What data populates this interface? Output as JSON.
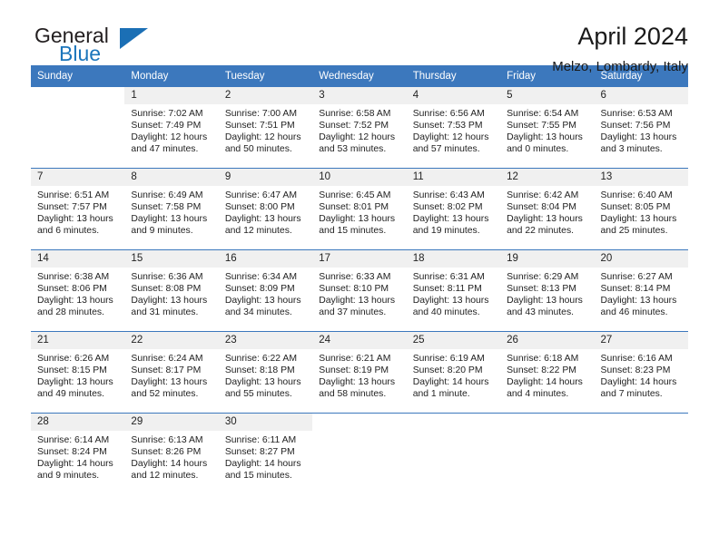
{
  "brand": {
    "name_top": "General",
    "name_bottom": "Blue",
    "triangle_color": "#1b6fb5",
    "blue_color": "#1b75bb"
  },
  "header": {
    "title": "April 2024",
    "subtitle": "Melzo, Lombardy, Italy"
  },
  "theme": {
    "header_blue": "#3c78bd",
    "daynum_band": "#f0f0f0",
    "text": "#222222"
  },
  "weekday_headers": [
    "Sunday",
    "Monday",
    "Tuesday",
    "Wednesday",
    "Thursday",
    "Friday",
    "Saturday"
  ],
  "labels": {
    "sunrise_prefix": "Sunrise:",
    "sunset_prefix": "Sunset:",
    "daylight_prefix": "Daylight:"
  },
  "weeks": [
    [
      {
        "day": "",
        "blank": true,
        "sunrise": "",
        "sunset": "",
        "daylight_line1": "",
        "daylight_line2": ""
      },
      {
        "day": "1",
        "sunrise": "Sunrise: 7:02 AM",
        "sunset": "Sunset: 7:49 PM",
        "daylight_line1": "Daylight: 12 hours",
        "daylight_line2": "and 47 minutes."
      },
      {
        "day": "2",
        "sunrise": "Sunrise: 7:00 AM",
        "sunset": "Sunset: 7:51 PM",
        "daylight_line1": "Daylight: 12 hours",
        "daylight_line2": "and 50 minutes."
      },
      {
        "day": "3",
        "sunrise": "Sunrise: 6:58 AM",
        "sunset": "Sunset: 7:52 PM",
        "daylight_line1": "Daylight: 12 hours",
        "daylight_line2": "and 53 minutes."
      },
      {
        "day": "4",
        "sunrise": "Sunrise: 6:56 AM",
        "sunset": "Sunset: 7:53 PM",
        "daylight_line1": "Daylight: 12 hours",
        "daylight_line2": "and 57 minutes."
      },
      {
        "day": "5",
        "sunrise": "Sunrise: 6:54 AM",
        "sunset": "Sunset: 7:55 PM",
        "daylight_line1": "Daylight: 13 hours",
        "daylight_line2": "and 0 minutes."
      },
      {
        "day": "6",
        "sunrise": "Sunrise: 6:53 AM",
        "sunset": "Sunset: 7:56 PM",
        "daylight_line1": "Daylight: 13 hours",
        "daylight_line2": "and 3 minutes."
      }
    ],
    [
      {
        "day": "7",
        "sunrise": "Sunrise: 6:51 AM",
        "sunset": "Sunset: 7:57 PM",
        "daylight_line1": "Daylight: 13 hours",
        "daylight_line2": "and 6 minutes."
      },
      {
        "day": "8",
        "sunrise": "Sunrise: 6:49 AM",
        "sunset": "Sunset: 7:58 PM",
        "daylight_line1": "Daylight: 13 hours",
        "daylight_line2": "and 9 minutes."
      },
      {
        "day": "9",
        "sunrise": "Sunrise: 6:47 AM",
        "sunset": "Sunset: 8:00 PM",
        "daylight_line1": "Daylight: 13 hours",
        "daylight_line2": "and 12 minutes."
      },
      {
        "day": "10",
        "sunrise": "Sunrise: 6:45 AM",
        "sunset": "Sunset: 8:01 PM",
        "daylight_line1": "Daylight: 13 hours",
        "daylight_line2": "and 15 minutes."
      },
      {
        "day": "11",
        "sunrise": "Sunrise: 6:43 AM",
        "sunset": "Sunset: 8:02 PM",
        "daylight_line1": "Daylight: 13 hours",
        "daylight_line2": "and 19 minutes."
      },
      {
        "day": "12",
        "sunrise": "Sunrise: 6:42 AM",
        "sunset": "Sunset: 8:04 PM",
        "daylight_line1": "Daylight: 13 hours",
        "daylight_line2": "and 22 minutes."
      },
      {
        "day": "13",
        "sunrise": "Sunrise: 6:40 AM",
        "sunset": "Sunset: 8:05 PM",
        "daylight_line1": "Daylight: 13 hours",
        "daylight_line2": "and 25 minutes."
      }
    ],
    [
      {
        "day": "14",
        "sunrise": "Sunrise: 6:38 AM",
        "sunset": "Sunset: 8:06 PM",
        "daylight_line1": "Daylight: 13 hours",
        "daylight_line2": "and 28 minutes."
      },
      {
        "day": "15",
        "sunrise": "Sunrise: 6:36 AM",
        "sunset": "Sunset: 8:08 PM",
        "daylight_line1": "Daylight: 13 hours",
        "daylight_line2": "and 31 minutes."
      },
      {
        "day": "16",
        "sunrise": "Sunrise: 6:34 AM",
        "sunset": "Sunset: 8:09 PM",
        "daylight_line1": "Daylight: 13 hours",
        "daylight_line2": "and 34 minutes."
      },
      {
        "day": "17",
        "sunrise": "Sunrise: 6:33 AM",
        "sunset": "Sunset: 8:10 PM",
        "daylight_line1": "Daylight: 13 hours",
        "daylight_line2": "and 37 minutes."
      },
      {
        "day": "18",
        "sunrise": "Sunrise: 6:31 AM",
        "sunset": "Sunset: 8:11 PM",
        "daylight_line1": "Daylight: 13 hours",
        "daylight_line2": "and 40 minutes."
      },
      {
        "day": "19",
        "sunrise": "Sunrise: 6:29 AM",
        "sunset": "Sunset: 8:13 PM",
        "daylight_line1": "Daylight: 13 hours",
        "daylight_line2": "and 43 minutes."
      },
      {
        "day": "20",
        "sunrise": "Sunrise: 6:27 AM",
        "sunset": "Sunset: 8:14 PM",
        "daylight_line1": "Daylight: 13 hours",
        "daylight_line2": "and 46 minutes."
      }
    ],
    [
      {
        "day": "21",
        "sunrise": "Sunrise: 6:26 AM",
        "sunset": "Sunset: 8:15 PM",
        "daylight_line1": "Daylight: 13 hours",
        "daylight_line2": "and 49 minutes."
      },
      {
        "day": "22",
        "sunrise": "Sunrise: 6:24 AM",
        "sunset": "Sunset: 8:17 PM",
        "daylight_line1": "Daylight: 13 hours",
        "daylight_line2": "and 52 minutes."
      },
      {
        "day": "23",
        "sunrise": "Sunrise: 6:22 AM",
        "sunset": "Sunset: 8:18 PM",
        "daylight_line1": "Daylight: 13 hours",
        "daylight_line2": "and 55 minutes."
      },
      {
        "day": "24",
        "sunrise": "Sunrise: 6:21 AM",
        "sunset": "Sunset: 8:19 PM",
        "daylight_line1": "Daylight: 13 hours",
        "daylight_line2": "and 58 minutes."
      },
      {
        "day": "25",
        "sunrise": "Sunrise: 6:19 AM",
        "sunset": "Sunset: 8:20 PM",
        "daylight_line1": "Daylight: 14 hours",
        "daylight_line2": "and 1 minute."
      },
      {
        "day": "26",
        "sunrise": "Sunrise: 6:18 AM",
        "sunset": "Sunset: 8:22 PM",
        "daylight_line1": "Daylight: 14 hours",
        "daylight_line2": "and 4 minutes."
      },
      {
        "day": "27",
        "sunrise": "Sunrise: 6:16 AM",
        "sunset": "Sunset: 8:23 PM",
        "daylight_line1": "Daylight: 14 hours",
        "daylight_line2": "and 7 minutes."
      }
    ],
    [
      {
        "day": "28",
        "sunrise": "Sunrise: 6:14 AM",
        "sunset": "Sunset: 8:24 PM",
        "daylight_line1": "Daylight: 14 hours",
        "daylight_line2": "and 9 minutes."
      },
      {
        "day": "29",
        "sunrise": "Sunrise: 6:13 AM",
        "sunset": "Sunset: 8:26 PM",
        "daylight_line1": "Daylight: 14 hours",
        "daylight_line2": "and 12 minutes."
      },
      {
        "day": "30",
        "sunrise": "Sunrise: 6:11 AM",
        "sunset": "Sunset: 8:27 PM",
        "daylight_line1": "Daylight: 14 hours",
        "daylight_line2": "and 15 minutes."
      },
      {
        "day": "",
        "blank": true,
        "sunrise": "",
        "sunset": "",
        "daylight_line1": "",
        "daylight_line2": ""
      },
      {
        "day": "",
        "blank": true,
        "sunrise": "",
        "sunset": "",
        "daylight_line1": "",
        "daylight_line2": ""
      },
      {
        "day": "",
        "blank": true,
        "sunrise": "",
        "sunset": "",
        "daylight_line1": "",
        "daylight_line2": ""
      },
      {
        "day": "",
        "blank": true,
        "sunrise": "",
        "sunset": "",
        "daylight_line1": "",
        "daylight_line2": ""
      }
    ]
  ]
}
